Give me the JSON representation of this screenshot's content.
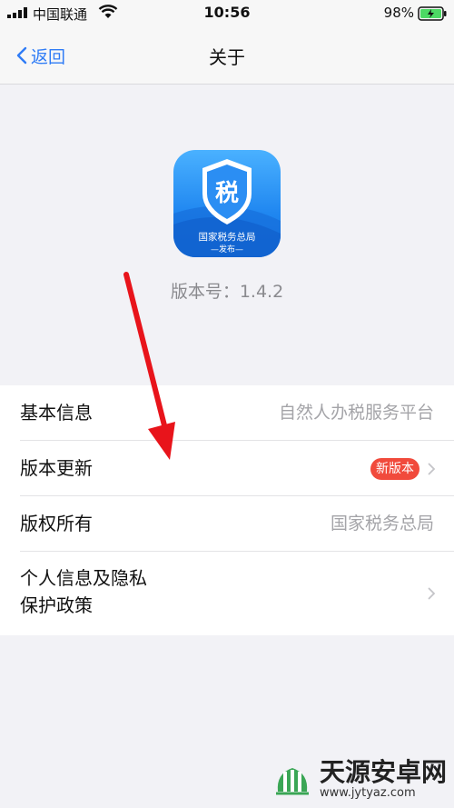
{
  "status_bar": {
    "carrier": "中国联通",
    "time": "10:56",
    "battery": "98%"
  },
  "nav": {
    "back_label": "返回",
    "title": "关于"
  },
  "app": {
    "icon_name": "tax-shield-icon",
    "icon_char": "税",
    "icon_caption": "国家税务总局",
    "icon_subcaption": "—发布—",
    "version_text": "版本号：1.4.2"
  },
  "list": {
    "rows": [
      {
        "label": "基本信息",
        "value": "自然人办税服务平台"
      },
      {
        "label": "版本更新",
        "badge": "新版本"
      },
      {
        "label": "版权所有",
        "value": "国家税务总局"
      },
      {
        "label": "个人信息及隐私保护政策"
      }
    ]
  },
  "watermark": {
    "title": "天源安卓网",
    "subtitle": "www.jytyaz.com"
  },
  "colors": {
    "accent": "#2f7cf6",
    "badge": "#f14a3c",
    "arrow": "#e8141b",
    "background": "#f2f2f6"
  }
}
